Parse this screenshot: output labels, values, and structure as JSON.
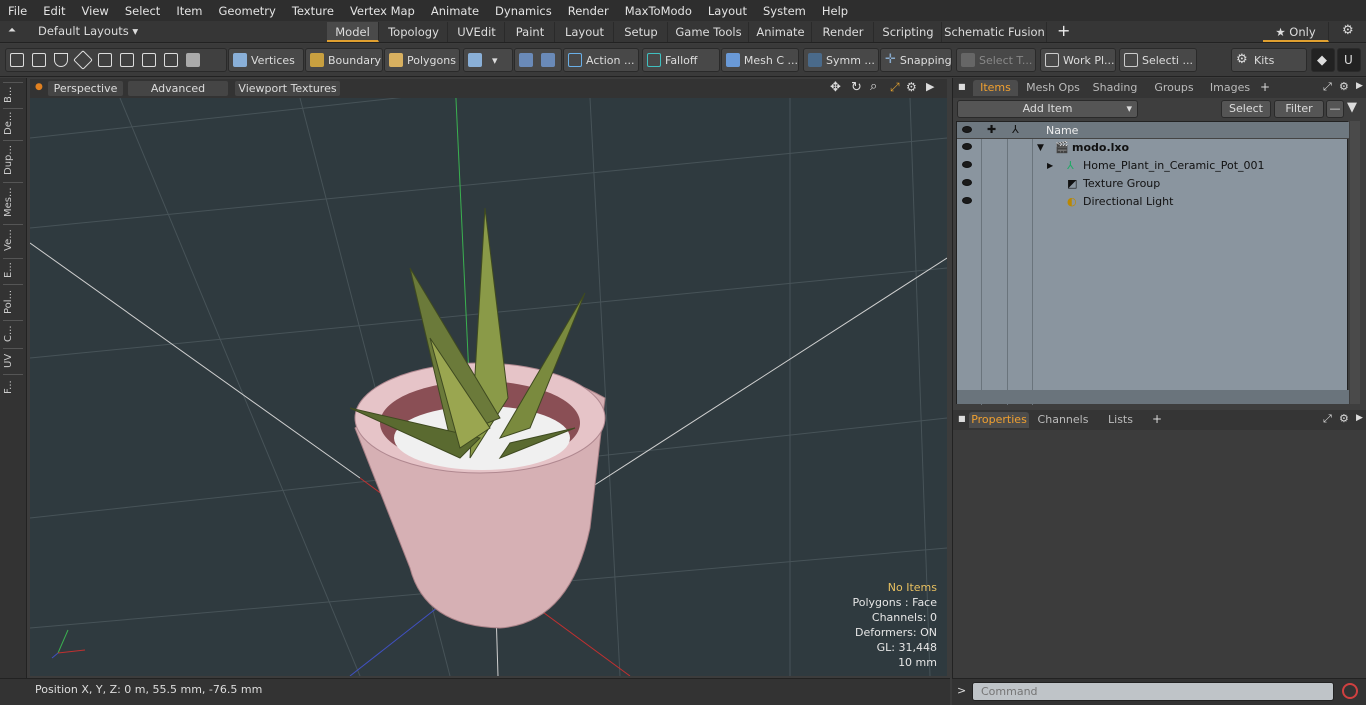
{
  "menu": [
    "File",
    "Edit",
    "View",
    "Select",
    "Item",
    "Geometry",
    "Texture",
    "Vertex Map",
    "Animate",
    "Dynamics",
    "Render",
    "MaxToModo",
    "Layout",
    "System",
    "Help"
  ],
  "layout_selector": "Default Layouts ▾",
  "layout_tabs": [
    "Model",
    "Topology",
    "UVEdit",
    "Paint",
    "Layout",
    "Setup",
    "Game Tools",
    "Animate",
    "Render",
    "Scripting",
    "Schematic Fusion"
  ],
  "only_label": "★ Only",
  "toolbar": {
    "vertices": "Vertices",
    "boundary": "Boundary",
    "polygons": "Polygons",
    "action": "Action ...",
    "falloff": "Falloff",
    "mesh": "Mesh C ...",
    "symm": "Symm ...",
    "snapping": "Snapping",
    "select_t": "Select T...",
    "work_pl": "Work Pl...",
    "selecti": "Selecti ...",
    "kits": "Kits"
  },
  "left_tabs": [
    "B...",
    "De...",
    "Dup...",
    "Mes...",
    "Ve...",
    "E...",
    "Pol...",
    "C...",
    "UV",
    "F..."
  ],
  "viewport": {
    "mode": "Perspective",
    "advanced": "Advanced",
    "textures": "Viewport Textures",
    "stats": {
      "no_items": "No Items",
      "polygons": "Polygons : Face",
      "channels": "Channels: 0",
      "deformers": "Deformers: ON",
      "gl": "GL: 31,448",
      "scale": "10 mm"
    }
  },
  "status": {
    "position": "Position X, Y, Z:   0 m, 55.5 mm, -76.5 mm"
  },
  "items_panel": {
    "tabs": [
      "Items",
      "Mesh Ops",
      "Shading",
      "Groups",
      "Images"
    ],
    "add_item": "Add Item",
    "select": "Select",
    "filter": "Filter",
    "name_header": "Name",
    "rows": [
      {
        "label": "modo.lxo"
      },
      {
        "label": "Home_Plant_in_Ceramic_Pot_001"
      },
      {
        "label": "Texture Group"
      },
      {
        "label": "Directional Light"
      }
    ]
  },
  "props_panel": {
    "tabs": [
      "Properties",
      "Channels",
      "Lists"
    ]
  },
  "command": {
    "placeholder": "Command"
  },
  "colors": {
    "accent": "#e0a030",
    "viewport_bg": "#2f3a3f",
    "tree_bg": "#8a959f"
  }
}
